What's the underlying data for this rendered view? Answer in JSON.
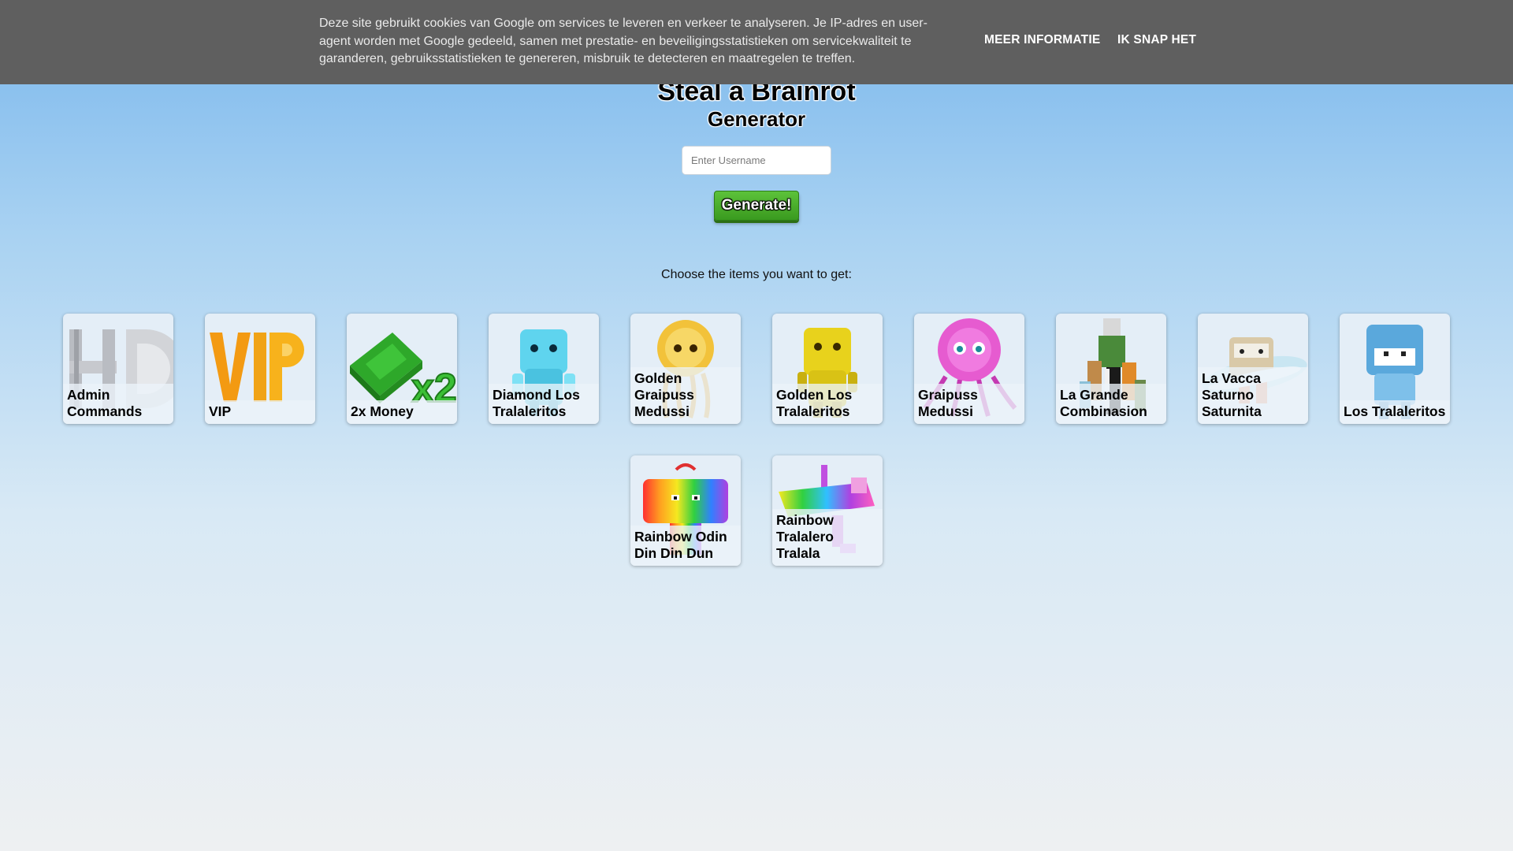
{
  "cookie": {
    "text": "Deze site gebruikt cookies van Google om services te leveren en verkeer te analyseren. Je IP-adres en user-agent worden met Google gedeeld, samen met prestatie- en beveiligingsstatistieken om servicekwaliteit te garanderen, gebruiksstatistieken te genereren, misbruik te detecteren en maatregelen te treffen.",
    "more_label": "MEER INFORMATIE",
    "ok_label": "IK SNAP HET"
  },
  "header": {
    "title": "Steal a Brainrot",
    "subtitle": "Generator"
  },
  "form": {
    "username_placeholder": "Enter Username",
    "generate_label": "Generate!"
  },
  "choose_text": "Choose the items you want to get:",
  "items": [
    {
      "label": "Admin Commands",
      "icon": "admin-commands-icon"
    },
    {
      "label": "VIP",
      "icon": "vip-icon"
    },
    {
      "label": "2x Money",
      "icon": "money-icon"
    },
    {
      "label": "Diamond Los Tralaleritos",
      "icon": "diamond-tralaleritos-icon"
    },
    {
      "label": "Golden Graipuss Medussi",
      "icon": "golden-graipuss-icon"
    },
    {
      "label": "Golden Los Tralaleritos",
      "icon": "golden-tralaleritos-icon"
    },
    {
      "label": "Graipuss Medussi",
      "icon": "graipuss-icon"
    },
    {
      "label": "La Grande Combinasion",
      "icon": "la-grande-combinasion-icon"
    },
    {
      "label": "La Vacca Saturno Saturnita",
      "icon": "la-vacca-saturno-icon"
    },
    {
      "label": "Los Tralaleritos",
      "icon": "tralaleritos-icon"
    },
    {
      "label": "Rainbow Odin Din Din Dun",
      "icon": "rainbow-odin-icon"
    },
    {
      "label": "Rainbow Tralalero Tralala",
      "icon": "rainbow-tralalero-icon"
    }
  ]
}
